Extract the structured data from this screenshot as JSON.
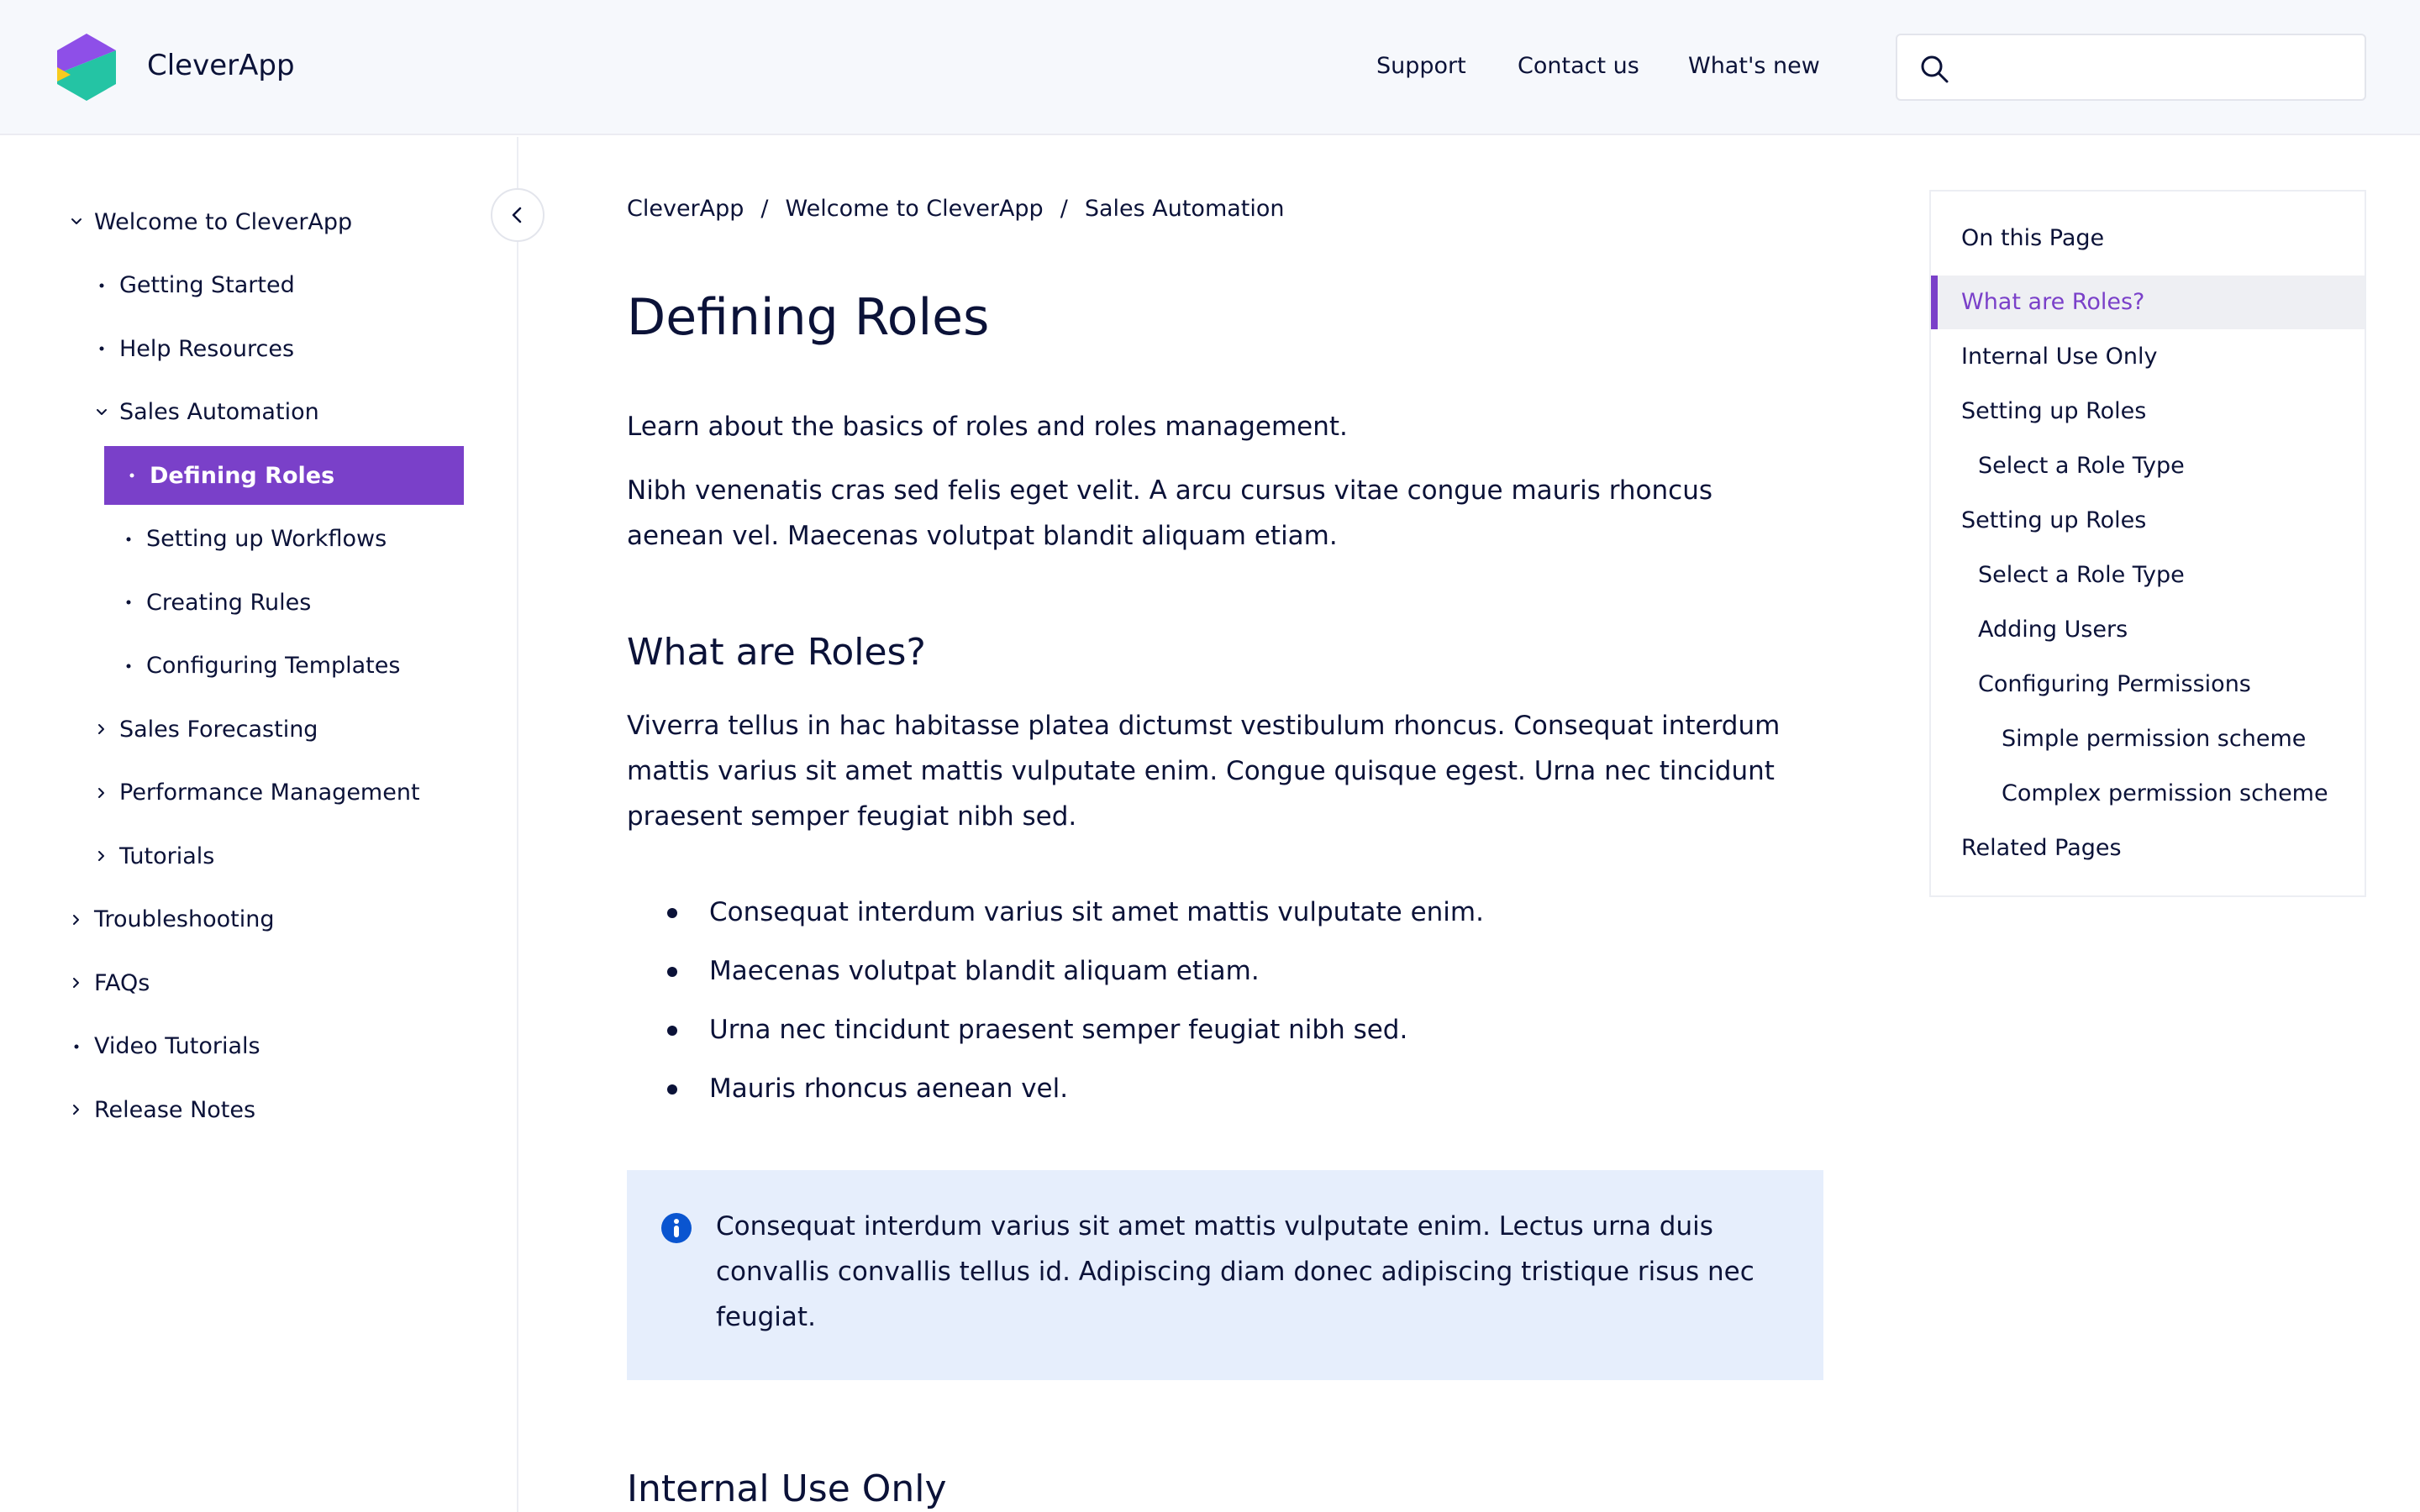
{
  "header": {
    "brand": "CleverApp",
    "nav": [
      "Support",
      "Contact us",
      "What's new"
    ],
    "search": {
      "value": "",
      "placeholder": ""
    }
  },
  "sidebar": {
    "items": [
      {
        "label": "Welcome to CleverApp",
        "icon": "chevron-down-icon",
        "level": 0,
        "active": false
      },
      {
        "label": "Getting Started",
        "icon": "bullet-icon",
        "level": 1,
        "active": false
      },
      {
        "label": "Help Resources",
        "icon": "bullet-icon",
        "level": 1,
        "active": false
      },
      {
        "label": "Sales Automation",
        "icon": "chevron-down-icon",
        "level": 1,
        "active": false
      },
      {
        "label": "Defining Roles",
        "icon": "bullet-icon",
        "level": 2,
        "active": true
      },
      {
        "label": "Setting up Workflows",
        "icon": "bullet-icon",
        "level": 2,
        "active": false
      },
      {
        "label": "Creating Rules",
        "icon": "bullet-icon",
        "level": 2,
        "active": false
      },
      {
        "label": "Configuring Templates",
        "icon": "bullet-icon",
        "level": 2,
        "active": false
      },
      {
        "label": "Sales Forecasting",
        "icon": "chevron-right-icon",
        "level": 1,
        "active": false
      },
      {
        "label": "Performance Management",
        "icon": "chevron-right-icon",
        "level": 1,
        "active": false
      },
      {
        "label": "Tutorials",
        "icon": "chevron-right-icon",
        "level": 1,
        "active": false
      },
      {
        "label": "Troubleshooting",
        "icon": "chevron-right-icon",
        "level": 0,
        "active": false
      },
      {
        "label": "FAQs",
        "icon": "chevron-right-icon",
        "level": 0,
        "active": false
      },
      {
        "label": "Video Tutorials",
        "icon": "bullet-icon",
        "level": 0,
        "active": false
      },
      {
        "label": "Release Notes",
        "icon": "chevron-right-icon",
        "level": 0,
        "active": false
      }
    ]
  },
  "breadcrumb": [
    "CleverApp",
    "Welcome to CleverApp",
    "Sales Automation"
  ],
  "breadcrumb_separator": "/",
  "article": {
    "title": "Defining Roles",
    "lead": "Learn about the basics of roles and roles management.",
    "intro": "Nibh venenatis cras sed felis eget velit. A arcu cursus vitae congue mauris rhoncus aenean vel. Maecenas volutpat blandit aliquam etiam.",
    "section1": {
      "heading": "What are Roles?",
      "body": "Viverra tellus in hac habitasse platea dictumst vestibulum rhoncus. Consequat interdum mattis varius sit amet mattis vulputate enim. Congue quisque egest. Urna nec tincidunt praesent semper feugiat nibh sed.",
      "bullets": [
        "Consequat interdum varius sit amet mattis vulputate enim.",
        "Maecenas volutpat blandit aliquam etiam.",
        "Urna nec tincidunt praesent semper feugiat nibh sed.",
        "Mauris rhoncus aenean vel."
      ],
      "callout": "Consequat interdum varius sit amet mattis vulputate enim. Lectus urna duis convallis convallis tellus id. Adipiscing diam donec adipiscing tristique risus nec feugiat."
    },
    "section2": {
      "heading": "Internal Use Only"
    }
  },
  "toc": {
    "title": "On this Page",
    "items": [
      {
        "label": "What are Roles?",
        "level": 0,
        "active": true
      },
      {
        "label": "Internal Use Only",
        "level": 0,
        "active": false
      },
      {
        "label": "Setting up Roles",
        "level": 0,
        "active": false
      },
      {
        "label": "Select a Role Type",
        "level": 1,
        "active": false
      },
      {
        "label": "Setting up Roles",
        "level": 0,
        "active": false
      },
      {
        "label": "Select a Role Type",
        "level": 1,
        "active": false
      },
      {
        "label": "Adding Users",
        "level": 1,
        "active": false
      },
      {
        "label": "Configuring Permissions",
        "level": 1,
        "active": false
      },
      {
        "label": "Simple permission scheme",
        "level": 2,
        "active": false
      },
      {
        "label": "Complex permission scheme",
        "level": 2,
        "active": false
      },
      {
        "label": "Related Pages",
        "level": 0,
        "active": false
      }
    ]
  },
  "colors": {
    "accent": "#7a40c9",
    "text": "#0b1238",
    "header_bg": "#f6f8fc",
    "callout_bg": "#e6eefc",
    "info_icon": "#0a55d0",
    "logo_purple": "#8e4fe8",
    "logo_teal": "#24c4a4",
    "logo_yellow": "#f7cb1e"
  }
}
